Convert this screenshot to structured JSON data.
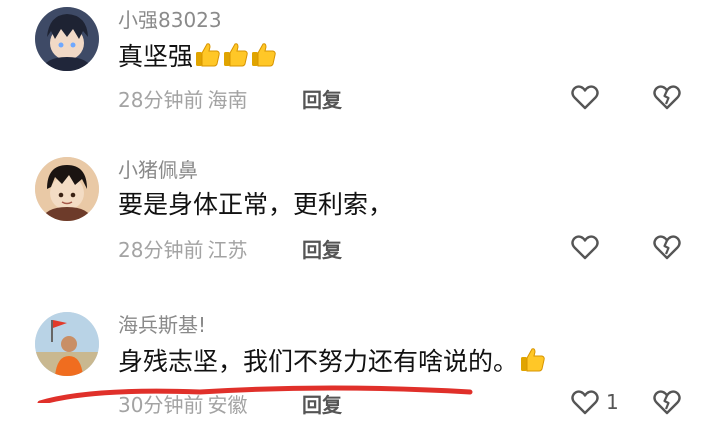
{
  "comments": [
    {
      "username": "小强83023",
      "content": "真坚强",
      "thumbs": 3,
      "time": "28分钟前",
      "location": "海南",
      "reply_label": "回复",
      "like_count": ""
    },
    {
      "username": "小猪佩鼻",
      "content": "要是身体正常，更利索，",
      "thumbs": 0,
      "time": "28分钟前",
      "location": "江苏",
      "reply_label": "回复",
      "like_count": ""
    },
    {
      "username": "海兵斯基!",
      "content": "身残志坚，我们不努力还有啥说的。",
      "thumbs": 1,
      "time": "30分钟前",
      "location": "安徽",
      "reply_label": "回复",
      "like_count": "1"
    }
  ],
  "icons": {
    "like": "heart-outline-icon",
    "dislike": "broken-heart-icon",
    "thumb": "thumbs-up-emoji"
  },
  "colors": {
    "username": "#8a8a8a",
    "meta": "#a3a3a3",
    "content": "#111111",
    "annotation": "#e0302a"
  }
}
